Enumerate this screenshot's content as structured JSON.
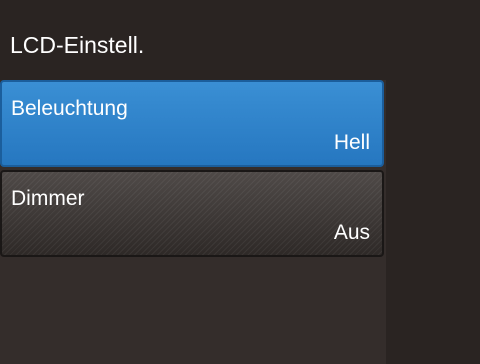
{
  "header": {
    "title": "LCD-Einstell."
  },
  "menu": {
    "items": [
      {
        "label": "Beleuchtung",
        "value": "Hell",
        "selected": true
      },
      {
        "label": "Dimmer",
        "value": "Aus",
        "selected": false
      }
    ]
  },
  "colors": {
    "background": "#2a2422",
    "selected_item": "#2f82c8",
    "item_normal": "#3a3533",
    "text": "#ffffff"
  }
}
